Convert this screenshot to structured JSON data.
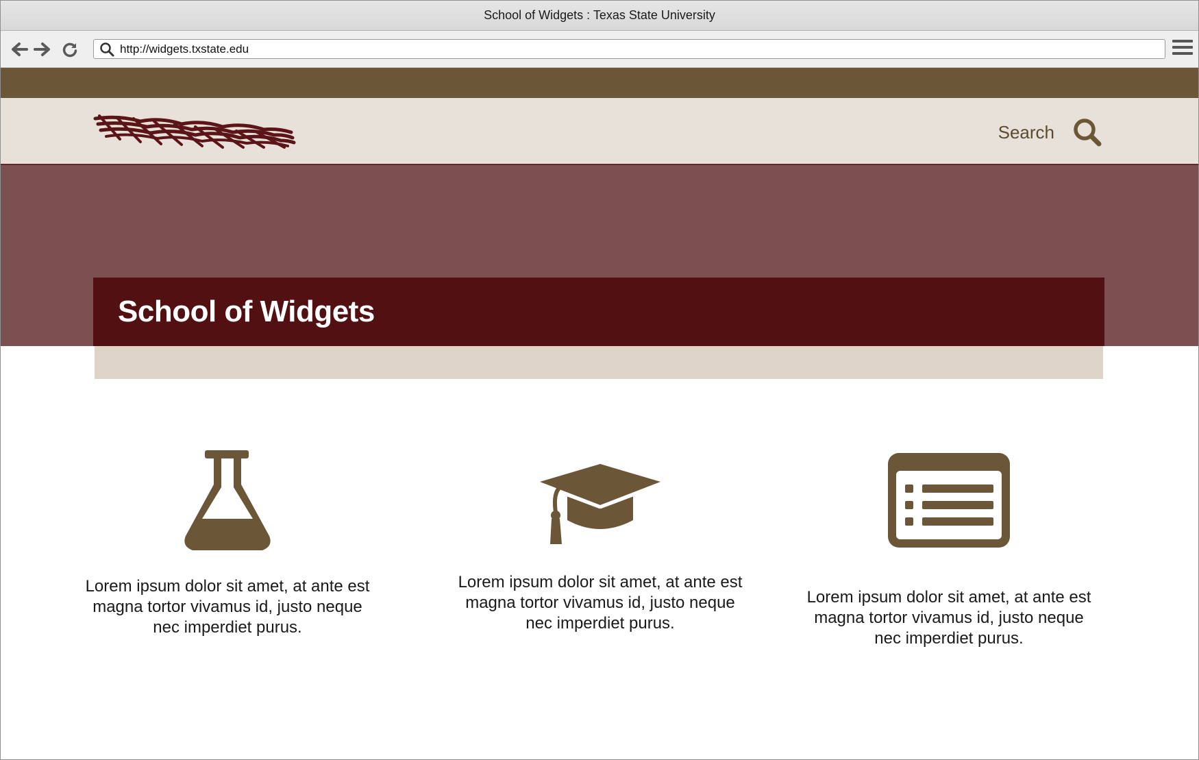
{
  "window": {
    "title": "School of Widgets : Texas State University"
  },
  "toolbar": {
    "back_icon": "back-arrow-icon",
    "forward_icon": "forward-arrow-icon",
    "reload_icon": "reload-icon",
    "url": "http://widgets.txstate.edu",
    "menu_icon": "hamburger-menu-icon"
  },
  "header": {
    "search_label": "Search",
    "search_icon": "magnifier-icon"
  },
  "hero": {
    "title": "School of Widgets"
  },
  "features": [
    {
      "icon": "flask-icon",
      "text": "Lorem ipsum dolor sit amet, at ante est magna tortor vivamus id, justo neque nec imperdiet purus."
    },
    {
      "icon": "graduation-cap-icon",
      "text": "Lorem ipsum dolor sit amet, at ante est magna tortor vivamus id, justo neque nec imperdiet purus."
    },
    {
      "icon": "list-icon",
      "text": "Lorem ipsum dolor sit amet, at ante est magna tortor vivamus id, justo neque nec imperdiet purus."
    }
  ],
  "colors": {
    "brown": "#6b5638",
    "header_bg": "#e7e1d9",
    "hero_bg": "#7c4f51",
    "maroon": "#521013",
    "sand": "#ddd3c6"
  }
}
